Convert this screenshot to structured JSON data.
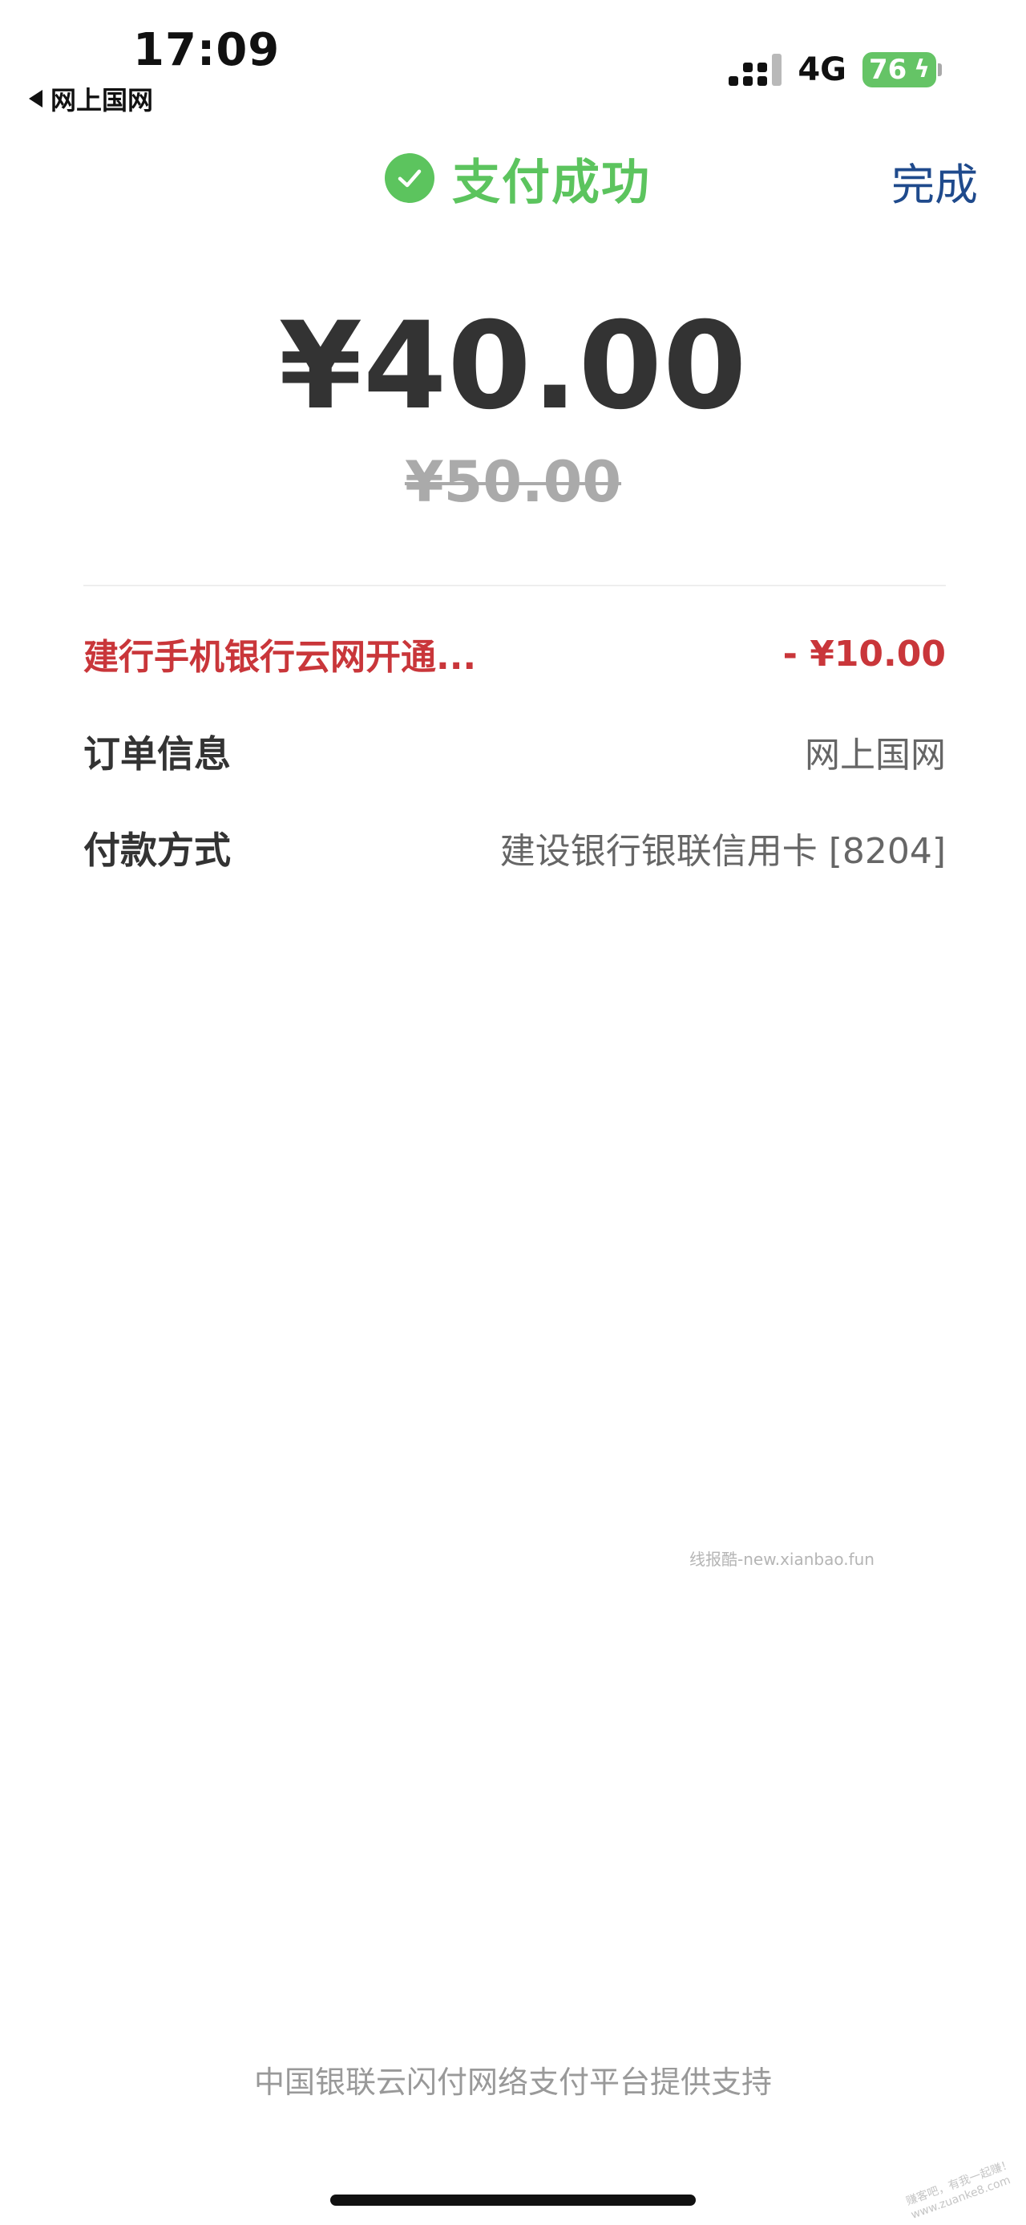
{
  "status_bar": {
    "time": "17:09",
    "back_app": "网上国网",
    "network": "4G",
    "battery": "76"
  },
  "header": {
    "title": "支付成功",
    "done_label": "完成",
    "success_color": "#5cc45e"
  },
  "amount": {
    "paid": "¥40.00",
    "original": "¥50.00"
  },
  "details": {
    "promo": {
      "label": "建行手机银行云网开通...",
      "value": "- ¥10.00"
    },
    "order": {
      "label": "订单信息",
      "value": "网上国网"
    },
    "payment": {
      "label": "付款方式",
      "value": "建设银行银联信用卡 [8204]"
    }
  },
  "watermark": "线报酷-new.xianbao.fun",
  "footer": "中国银联云闪付网络支付平台提供支持",
  "corner_stamp": "赚客吧，有我一起赚！www.zuanke8.com"
}
